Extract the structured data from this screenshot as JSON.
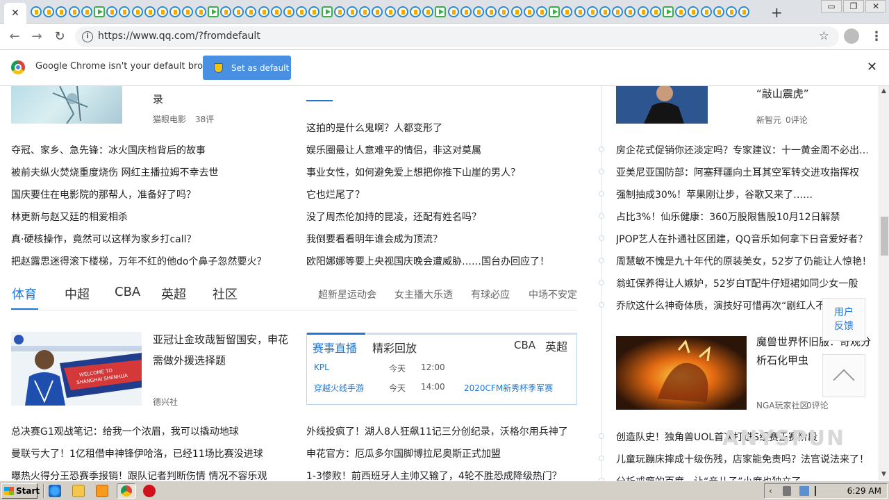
{
  "browser": {
    "close_tab": "✕",
    "new_tab": "+",
    "url": "https://www.qq.com/?fromdefault",
    "window_buttons": [
      "▭",
      "❐",
      "✕"
    ]
  },
  "infobar": {
    "message": "Google Chrome isn't your default browser",
    "button": "Set as default",
    "close": "✕"
  },
  "top_section": {
    "left_col": {
      "feature_title": "录",
      "feature_source": "猫眼电影",
      "feature_comments": "38评",
      "headlines": [
        "夺冠、家乡、急先锋：冰火国庆档背后的故事",
        "被前夫纵火焚烧重度烧伤 网红主播拉姆不幸去世",
        "国庆要住在电影院的那帮人，准备好了吗？",
        "林更新与赵又廷的相爱相杀",
        "真·硬核操作，竟然可以这样为家乡打call？",
        "把赵露思迷得滚下楼梯，万年不红的他do个鼻子忽然要火？"
      ]
    },
    "mid_col": {
      "headlines": [
        "这拍的是什么鬼啊？人都变形了",
        "娱乐圈最让人意难平的情侣，非这对莫属",
        "事业女性，如何避免爱上想把你推下山崖的男人？",
        "它也烂尾了？",
        "没了周杰伦加持的昆凌，还配有姓名吗？",
        "我倒要看看明年谁会成为顶流？",
        "欧阳娜娜等要上央视国庆晚会遭威胁……国台办回应了！"
      ]
    }
  },
  "sports": {
    "tabs": [
      "体育",
      "中超",
      "CBA",
      "英超",
      "社区"
    ],
    "links": [
      "超新星运动会",
      "女主播大乐透",
      "有球必应",
      "中场不安定"
    ],
    "feature": {
      "title_line1": "亚冠让金玫哉暂留国安，申花",
      "title_line2": "需做外援选择题",
      "source": "德兴社",
      "banner_line1": "WELCOME TO",
      "banner_line2": "SHANGHAI SHENHUA"
    },
    "score_panel": {
      "tab_live": "赛事直播",
      "tab_replay": "精彩回放",
      "tab_cba": "CBA",
      "tab_epl": "英超",
      "rows": [
        {
          "name": "KPL",
          "day": "今天",
          "time": "12:00",
          "event": ""
        },
        {
          "name": "穿越火线手游",
          "day": "今天",
          "time": "14:00",
          "event": "2020CFM新秀杯季军赛"
        }
      ]
    },
    "left_headlines": [
      "总决赛G1观战笔记：给我一个浓眉，我可以撬动地球",
      "曼联亏大了！1亿租借申神锋伊哈洛，已经11场比赛没进球",
      "曝热火得分王恐赛季报销！跟队记者判断伤情 情况不容乐观"
    ],
    "mid_headlines": [
      "外线投疯了！湖人8人狂飙11记三分创纪录，沃格尔用兵神了",
      "申花官方：厄瓜多尔国脚博拉尼奥斯正式加盟",
      "1-3惨败！前西班牙人主帅又输了，4轮不胜恐成降级热门？"
    ]
  },
  "right_column": {
    "top_feature": {
      "title": "“敲山震虎”",
      "source": "新智元",
      "comments": "0评论"
    },
    "headlines": [
      "房企花式促销你还淡定吗？专家建议：十一黄金周不必出…",
      "亚美尼亚国防部：阿塞拜疆向土耳其空军转交进攻指挥权",
      "强制抽成30%！苹果刚让步，谷歌又来了……",
      "占比3%！仙乐健康：360万股限售股10月12日解禁",
      "JPOP艺人在扑通社区团建，QQ音乐如何拿下日音爱好者？",
      "周慧敏不愧是九十年代的原装美女，52岁了仍能让人惊艳！",
      "翁虹保养得让人嫉妒，52岁白T配牛仔短裙如同少女一般",
      "乔欣这什么神奇体质，演技好可惜再次“剧红人不"
    ],
    "game_feature": {
      "title_line1": "魔兽世界怀旧服：奇观分",
      "title_line2": "析石化甲虫",
      "source": "NGA玩家社区",
      "comments": "0评论"
    },
    "bottom_headlines": [
      "创造队史！独角兽UOL首次打进S组赛正赛阶段",
      "儿童玩蹦床摔成十级伤残，店家能免责吗？法官说法来了！",
      "分析戒瘾的百度，让“亲儿子”小度也独立了"
    ]
  },
  "floating": {
    "feedback_line1": "用户",
    "feedback_line2": "反馈"
  },
  "taskbar": {
    "start": "Start",
    "clock": "6:29 AM"
  },
  "watermark": "ANYSPUN"
}
